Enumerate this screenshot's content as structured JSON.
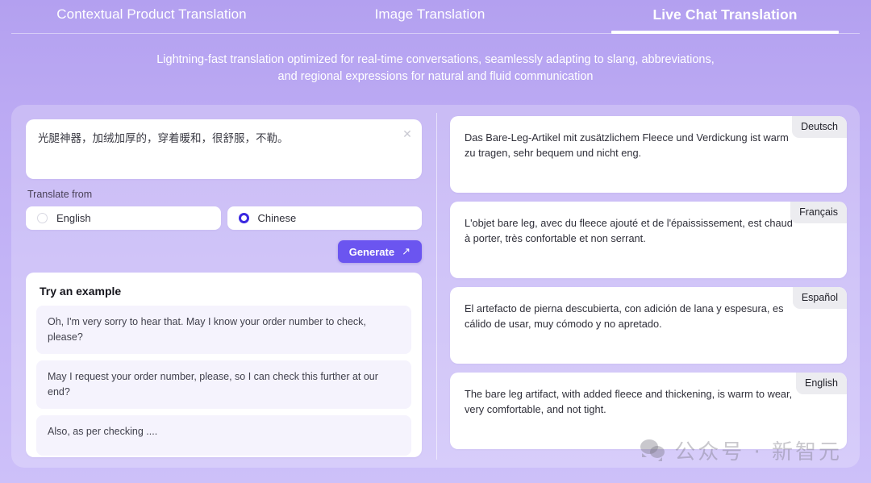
{
  "tabs": [
    {
      "label": "Contextual Product Translation",
      "active": false
    },
    {
      "label": "Image Translation",
      "active": false
    },
    {
      "label": "Live Chat Translation",
      "active": true
    }
  ],
  "subtitle": {
    "line1": "Lightning-fast translation optimized for real-time conversations, seamlessly adapting to slang, abbreviations,",
    "line2": "and regional expressions for natural and fluid communication"
  },
  "source": {
    "text": "光腿神器，加绒加厚的，穿着暖和，很舒服，不勒。",
    "clear_icon": "close-icon",
    "clear_glyph": "✕"
  },
  "translate_from": {
    "label": "Translate from",
    "options": [
      {
        "label": "English",
        "selected": false
      },
      {
        "label": "Chinese",
        "selected": true
      }
    ]
  },
  "generate": {
    "label": "Generate",
    "arrow": "↗",
    "color": "#6b55f0"
  },
  "examples": {
    "title": "Try an example",
    "items": [
      "Oh, I'm very sorry to hear that. May I know your order number to check, please?",
      "May I request your order number, please, so I can check this further at our end?",
      "Also, as per checking ...."
    ]
  },
  "results": [
    {
      "language": "Deutsch",
      "text": "Das Bare-Leg-Artikel mit zusätzlichem Fleece und Verdickung ist warm zu tragen, sehr bequem und nicht eng."
    },
    {
      "language": "Français",
      "text": "L'objet bare leg, avec du fleece ajouté et de l'épaississement, est chaud à porter, très confortable et non serrant."
    },
    {
      "language": "Español",
      "text": "El artefacto de pierna descubierta, con adición de lana y espesura, es cálido de usar, muy cómodo y no apretado."
    },
    {
      "language": "English",
      "text": "The bare leg artifact, with added fleece and thickening, is warm to wear, very comfortable, and not tight."
    }
  ],
  "watermark": {
    "text": "公众号 · 新智元",
    "icon": "wechat-icon"
  },
  "theme": {
    "background_top": "#b3a0f0",
    "background_bottom": "#cdc0f9",
    "accent": "#6b55f0",
    "radio_selected": "#3b28e0",
    "card_surface": "#ffffff",
    "example_surface": "#f5f3fd",
    "badge_surface": "#ececf0"
  }
}
